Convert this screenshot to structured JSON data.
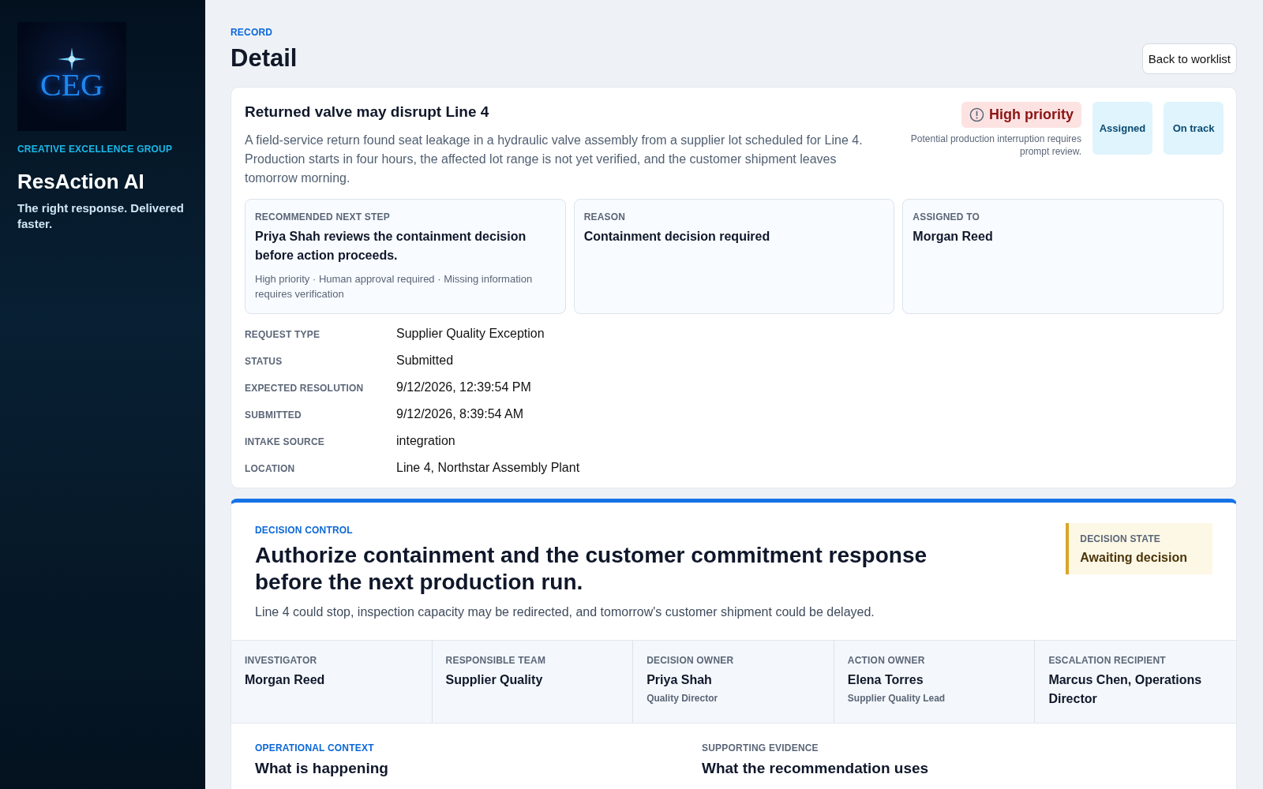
{
  "sidebar": {
    "logo_text": "CEG",
    "org": "CREATIVE EXCELLENCE GROUP",
    "app_name": "ResAction AI",
    "tagline": "The right response. Delivered faster."
  },
  "header": {
    "eyebrow": "RECORD",
    "title": "Detail",
    "back_button": "Back to worklist"
  },
  "record": {
    "title": "Returned valve may disrupt Line 4",
    "description": "A field-service return found seat leakage in a hydraulic valve assembly from a supplier lot scheduled for Line 4. Production starts in four hours, the affected lot range is not yet verified, and the customer shipment leaves tomorrow morning.",
    "priority": {
      "label": "High priority",
      "note": "Potential production interruption requires prompt review."
    },
    "badges": [
      "Assigned",
      "On track"
    ],
    "summary_cards": [
      {
        "label": "RECOMMENDED NEXT STEP",
        "value": "Priya Shah reviews the containment decision before action proceeds.",
        "note": "High priority · Human approval required · Missing information requires verification"
      },
      {
        "label": "REASON",
        "value": "Containment decision required"
      },
      {
        "label": "ASSIGNED TO",
        "value": "Morgan Reed"
      }
    ],
    "fields": [
      {
        "label": "REQUEST TYPE",
        "value": "Supplier Quality Exception"
      },
      {
        "label": "STATUS",
        "value": "Submitted"
      },
      {
        "label": "EXPECTED RESOLUTION",
        "value": "9/12/2026, 12:39:54 PM"
      },
      {
        "label": "SUBMITTED",
        "value": "9/12/2026, 8:39:54 AM"
      },
      {
        "label": "INTAKE SOURCE",
        "value": "integration"
      },
      {
        "label": "LOCATION",
        "value": "Line 4, Northstar Assembly Plant"
      }
    ]
  },
  "decision": {
    "eyebrow": "DECISION CONTROL",
    "title": "Authorize containment and the customer commitment response before the next production run.",
    "description": "Line 4 could stop, inspection capacity may be redirected, and tomorrow's customer shipment could be delayed.",
    "state": {
      "label": "DECISION STATE",
      "value": "Awaiting decision"
    },
    "people": [
      {
        "role": "INVESTIGATOR",
        "name": "Morgan Reed"
      },
      {
        "role": "RESPONSIBLE TEAM",
        "name": "Supplier Quality"
      },
      {
        "role": "DECISION OWNER",
        "name": "Priya Shah",
        "title": "Quality Director"
      },
      {
        "role": "ACTION OWNER",
        "name": "Elena Torres",
        "title": "Supplier Quality Lead"
      },
      {
        "role": "ESCALATION RECIPIENT",
        "name": "Marcus Chen, Operations Director"
      }
    ],
    "sections": [
      {
        "eyebrow": "OPERATIONAL CONTEXT",
        "heading": "What is happening",
        "accent": true
      },
      {
        "eyebrow": "SUPPORTING EVIDENCE",
        "heading": "What the recommendation uses",
        "accent": false
      }
    ]
  }
}
